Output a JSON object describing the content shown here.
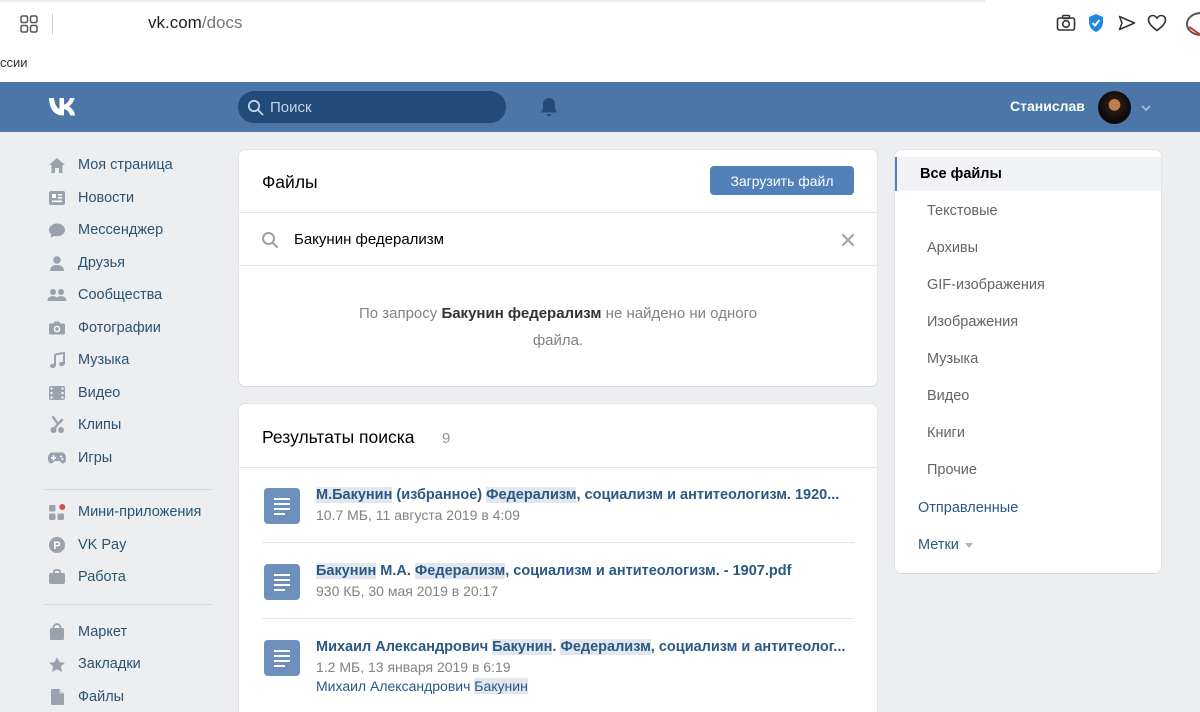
{
  "browser": {
    "url_host": "vk.com",
    "url_path": "/docs",
    "bookmark_text": "ссии"
  },
  "header": {
    "search_placeholder": "Поиск",
    "username": "Станислав"
  },
  "nav": {
    "items": [
      {
        "label": "Моя страница",
        "icon": "home-icon"
      },
      {
        "label": "Новости",
        "icon": "news-icon"
      },
      {
        "label": "Мессенджер",
        "icon": "messenger-icon"
      },
      {
        "label": "Друзья",
        "icon": "friends-icon"
      },
      {
        "label": "Сообщества",
        "icon": "communities-icon"
      },
      {
        "label": "Фотографии",
        "icon": "camera-icon"
      },
      {
        "label": "Музыка",
        "icon": "music-icon"
      },
      {
        "label": "Видео",
        "icon": "video-icon"
      },
      {
        "label": "Клипы",
        "icon": "clips-icon"
      },
      {
        "label": "Игры",
        "icon": "gamepad-icon"
      },
      {
        "label": "Мини-приложения",
        "icon": "mini-apps-icon"
      },
      {
        "label": "VK Pay",
        "icon": "vkpay-icon"
      },
      {
        "label": "Работа",
        "icon": "briefcase-icon"
      },
      {
        "label": "Маркет",
        "icon": "market-bag-icon"
      },
      {
        "label": "Закладки",
        "icon": "star-icon"
      },
      {
        "label": "Файлы",
        "icon": "file-icon"
      }
    ]
  },
  "files": {
    "title": "Файлы",
    "upload_label": "Загрузить файл",
    "query": "Бакунин федерализм",
    "empty_prefix": "По запросу ",
    "empty_query": "Бакунин федерализм",
    "empty_suffix_line1": " не найдено ни одного",
    "empty_line2": "файла."
  },
  "results": {
    "title": "Результаты поиска",
    "count": "9",
    "items": [
      {
        "title_parts": [
          {
            "text": "М.Бакунин",
            "hl": true
          },
          {
            "text": " (избранное) ",
            "hl": false
          },
          {
            "text": "Федерализм",
            "hl": true
          },
          {
            "text": ", социализм и антитеологизм. 1920...",
            "hl": false
          }
        ],
        "meta": "10.7 МБ, 11 августа 2019 в 4:09"
      },
      {
        "title_parts": [
          {
            "text": "Бакунин",
            "hl": true
          },
          {
            "text": " М.А. ",
            "hl": false
          },
          {
            "text": "Федерализм",
            "hl": true
          },
          {
            "text": ", социализм и антитеологизм. - 1907.pdf",
            "hl": false
          }
        ],
        "meta": "930 КБ, 30 мая 2019 в 20:17"
      },
      {
        "title_parts": [
          {
            "text": "Михаил Александрович ",
            "hl": false
          },
          {
            "text": "Бакунин",
            "hl": true
          },
          {
            "text": ". ",
            "hl": false
          },
          {
            "text": "Федерализм",
            "hl": true
          },
          {
            "text": ", социализм и антитеолог...",
            "hl": false
          }
        ],
        "meta": "1.2 МБ, 13 января 2019 в 6:19",
        "author_parts": [
          {
            "text": "Михаил Александрович ",
            "hl": false
          },
          {
            "text": "Бакунин",
            "hl": true
          }
        ]
      }
    ]
  },
  "filter_menu": {
    "items": [
      {
        "label": "Все файлы",
        "kind": "active"
      },
      {
        "label": "Текстовые",
        "kind": "sub"
      },
      {
        "label": "Архивы",
        "kind": "sub"
      },
      {
        "label": "GIF-изображения",
        "kind": "sub"
      },
      {
        "label": "Изображения",
        "kind": "sub"
      },
      {
        "label": "Музыка",
        "kind": "sub"
      },
      {
        "label": "Видео",
        "kind": "sub"
      },
      {
        "label": "Книги",
        "kind": "sub"
      },
      {
        "label": "Прочие",
        "kind": "sub"
      },
      {
        "label": "Отправленные",
        "kind": "top"
      },
      {
        "label": "Метки",
        "kind": "top",
        "dropdown": true
      }
    ]
  },
  "colors": {
    "header_bg": "#4a76a8",
    "link": "#2a5885",
    "button": "#5181b8",
    "page_bg": "#edeef0"
  }
}
